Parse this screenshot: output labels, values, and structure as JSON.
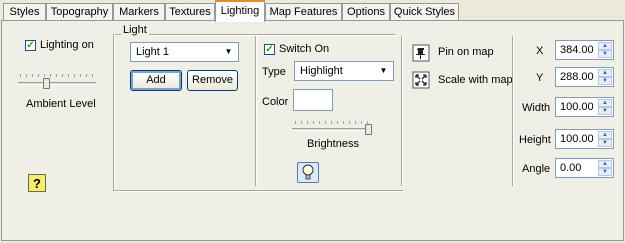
{
  "tabs": [
    "Styles",
    "Topography",
    "Markers",
    "Textures",
    "Lighting",
    "Map Features",
    "Options",
    "Quick Styles"
  ],
  "left": {
    "lighting_on_label": "Lighting on",
    "lighting_on_checked": true,
    "ambient_label": "Ambient Level",
    "help_icon": "question-mark"
  },
  "light": {
    "group_label": "Light",
    "selected_light": "Light 1",
    "add_label": "Add",
    "remove_label": "Remove",
    "switch_on_label": "Switch On",
    "switch_on_checked": true,
    "type_label": "Type",
    "type_value": "Highlight",
    "color_label": "Color",
    "color_value": "#ffffff",
    "brightness_label": "Brightness",
    "bulb_icon": "lightbulb"
  },
  "pin": {
    "pin_label": "Pin on map",
    "scale_label": "Scale with map"
  },
  "fields": {
    "x_label": "X",
    "x_value": "384.00",
    "y_label": "Y",
    "y_value": "288.00",
    "width_label": "Width",
    "width_value": "100.00",
    "height_label": "Height",
    "height_value": "100.00",
    "angle_label": "Angle",
    "angle_value": "0.00"
  }
}
